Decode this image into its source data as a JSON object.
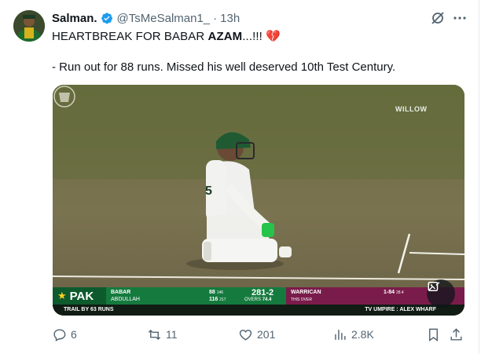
{
  "author": {
    "display_name": "Salman.",
    "handle": "@TsMeSalman1_",
    "separator": "·",
    "time": "13h",
    "verified_color": "#1d9bf0"
  },
  "post": {
    "line1_prefix": "HEARTBREAK FOR BABAR ",
    "line1_bold": "AZAM",
    "line1_suffix": "...!!! 💔",
    "line2": "- Run out for 88 runs. Missed his well deserved 10th Test Century."
  },
  "media": {
    "watermark": "WILLOW",
    "scorebar": {
      "team": "PAK",
      "batter1": "BABAR",
      "batter2": "ABDULLAH",
      "batter1_score": "88",
      "batter1_balls": "146",
      "batter2_score": "116",
      "batter2_balls": "217",
      "total": "281-2",
      "overs_label": "OVERS",
      "overs": "74.4",
      "bowler": "WARRICAN",
      "this_over": "THIS OVER",
      "figures": "1-84",
      "figures_overs": "28.4",
      "trail": "TRAIL BY 63 RUNS",
      "tv_umpire": "TV UMPIRE : ALEX WHARF"
    }
  },
  "actions": {
    "replies": "6",
    "reposts": "11",
    "likes": "201",
    "views": "2.8K"
  },
  "colors": {
    "text": "#0f1419",
    "secondary": "#536471",
    "pitch": "#6f6a49"
  }
}
